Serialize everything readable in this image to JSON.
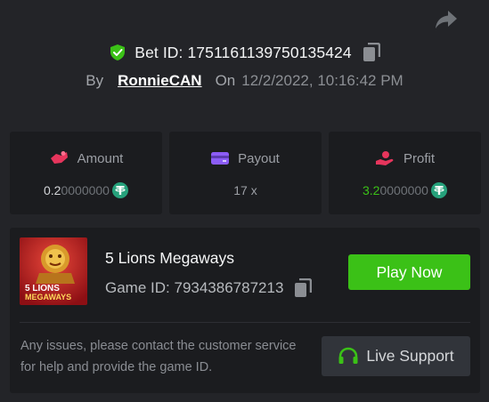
{
  "header": {
    "share_icon": "share-icon",
    "bet_label": "Bet ID:",
    "bet_id": "1751161139750135424",
    "by_label": "By",
    "username": "RonnieCAN",
    "on_label": "On",
    "datetime": "12/2/2022, 10:16:42 PM"
  },
  "stats": {
    "amount": {
      "label": "Amount",
      "value_hi": "0.2",
      "value_lo": "0000000",
      "icon": "amount-icon",
      "coin": "tether-icon"
    },
    "payout": {
      "label": "Payout",
      "value": "17 x",
      "icon": "wallet-icon"
    },
    "profit": {
      "label": "Profit",
      "value_hi": "3.2",
      "value_lo": "0000000",
      "icon": "profit-icon",
      "coin": "tether-icon"
    }
  },
  "game": {
    "name": "5 Lions Megaways",
    "id_label": "Game ID:",
    "id_value": "7934386787213",
    "thumb_line1": "5 LIONS",
    "thumb_line2": "MEGAWAYS",
    "play_label": "Play Now"
  },
  "support": {
    "help_text": "Any issues, please contact the customer service for help and provide the game ID.",
    "live_label": "Live Support"
  },
  "colors": {
    "background": "#232428",
    "card": "#1b1c1f",
    "accent_green": "#3bc117",
    "tether_green": "#26a17b"
  }
}
